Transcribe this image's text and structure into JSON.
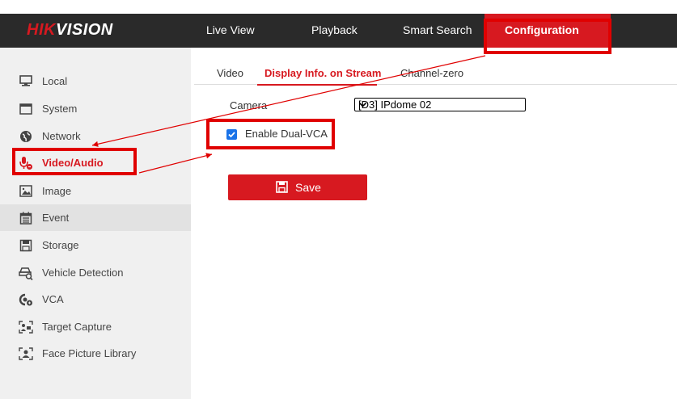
{
  "header": {
    "logo_red": "HIK",
    "logo_white": "VISION",
    "nav": [
      {
        "label": "Live View"
      },
      {
        "label": "Playback"
      },
      {
        "label": "Smart Search"
      },
      {
        "label": "Configuration"
      }
    ]
  },
  "sidebar": {
    "items": [
      {
        "label": "Local",
        "icon": "monitor-icon"
      },
      {
        "label": "System",
        "icon": "window-icon"
      },
      {
        "label": "Network",
        "icon": "globe-icon"
      },
      {
        "label": "Video/Audio",
        "icon": "microphone-icon"
      },
      {
        "label": "Image",
        "icon": "image-icon"
      },
      {
        "label": "Event",
        "icon": "calendar-icon"
      },
      {
        "label": "Storage",
        "icon": "floppy-disk-icon"
      },
      {
        "label": "Vehicle Detection",
        "icon": "vehicle-search-icon"
      },
      {
        "label": "VCA",
        "icon": "vca-icon"
      },
      {
        "label": "Target Capture",
        "icon": "target-capture-icon"
      },
      {
        "label": "Face Picture Library",
        "icon": "face-library-icon"
      }
    ],
    "active_index": 3
  },
  "tabs": [
    {
      "label": "Video"
    },
    {
      "label": "Display Info. on Stream"
    },
    {
      "label": "Channel-zero"
    }
  ],
  "form": {
    "camera_label": "Camera",
    "camera_value": "[D3] IPdome 02",
    "dual_vca_label": "Enable Dual-VCA",
    "dual_vca_checked": true,
    "save_label": "Save"
  },
  "colors": {
    "brand_red": "#d71920",
    "navbar": "#2a2a2a",
    "highlight": "#e00000",
    "checkbox": "#1a73e8"
  }
}
